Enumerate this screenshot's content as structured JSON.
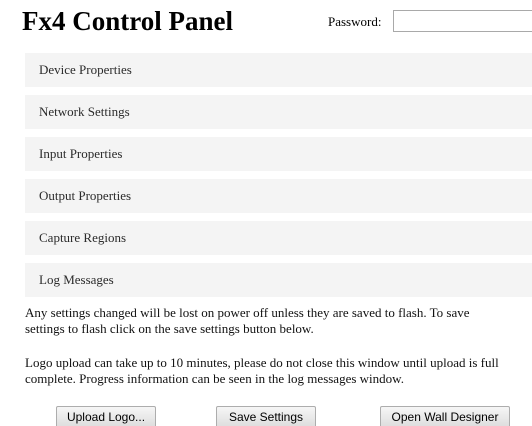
{
  "header": {
    "title": "Fx4 Control Panel",
    "password_label": "Password:",
    "password_value": ""
  },
  "sections": [
    {
      "label": "Device Properties"
    },
    {
      "label": "Network Settings"
    },
    {
      "label": "Input Properties"
    },
    {
      "label": "Output Properties"
    },
    {
      "label": "Capture Regions"
    },
    {
      "label": "Log Messages"
    }
  ],
  "notes": {
    "save_line1": "Any settings changed will be lost on power off unless they are saved to flash. To save",
    "save_line2": "settings to flash click on the save settings button below.",
    "logo_line1": "Logo upload can take up to 10 minutes, please do not close this window until upload is full",
    "logo_line2": "complete. Progress information can be seen in the log messages window."
  },
  "buttons": {
    "upload_logo": "Upload Logo...",
    "save_settings": "Save Settings",
    "open_wall_designer": "Open Wall Designer"
  }
}
